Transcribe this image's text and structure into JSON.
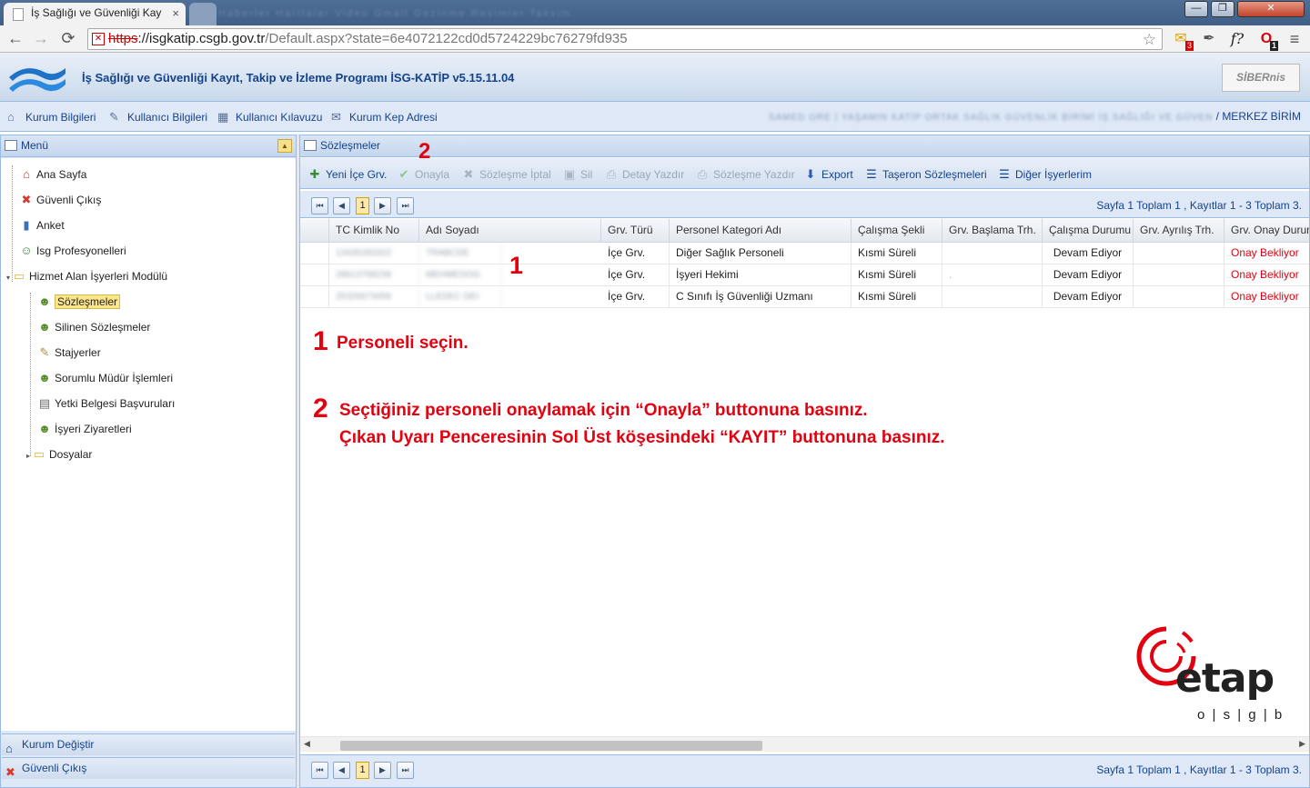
{
  "browser": {
    "tab_title": "İş Sağlığı ve Güvenliği Kay",
    "tab_close": "×",
    "blurred_tabs": "Haberler  Haritalar  Video  Gmail  Gezinme  Resimler  Takvim",
    "back": "←",
    "forward": "→",
    "reload": "⟳",
    "url_scheme": "https",
    "url_host": "://isgkatip.csgb.gov.tr",
    "url_path": "/Default.aspx?state=6e4072122cd0d5724229bc76279fd935",
    "star": "☆",
    "ext_mail_badge": "3",
    "ext_f": "f?",
    "ext_opera_badge": "1",
    "menu": "≡",
    "win_min": "—",
    "win_max": "❐",
    "win_close": "✕"
  },
  "app": {
    "title": "İş Sağlığı ve Güvenliği Kayıt, Takip ve İzleme Programı İSG-KATİP v5.15.11.04",
    "siber_logo": "SİBERnis",
    "topnav": [
      {
        "label": "Kurum Bilgileri",
        "icon": "home-icon",
        "glyph": "⌂"
      },
      {
        "label": "Kullanıcı Bilgileri",
        "icon": "user-pen-icon",
        "glyph": "✎"
      },
      {
        "label": "Kullanıcı Kılavuzu",
        "icon": "book-icon",
        "glyph": "▦"
      },
      {
        "label": "Kurum Kep Adresi",
        "icon": "mail-icon",
        "glyph": "✉"
      }
    ],
    "user_info_blurred": "SAMED ORE | YAŞAMIN KATİP ORTAK SAĞLIK GÜVENLİK BİRİMİ İŞ SAĞLIĞI VE GÜVEN",
    "user_info_suffix": " / MERKEZ BİRİM"
  },
  "menu": {
    "title": "Menü",
    "collapse": "▲",
    "items": [
      {
        "label": "Ana Sayfa",
        "icon": "home-icon",
        "glyph": "⌂",
        "color": "#c0392b"
      },
      {
        "label": "Güvenli Çıkış",
        "icon": "exit-icon",
        "glyph": "✖",
        "color": "#d63a2f"
      },
      {
        "label": "Anket",
        "icon": "chart-icon",
        "glyph": "▮",
        "color": "#3f6fb5"
      },
      {
        "label": "Isg Profesyonelleri",
        "icon": "users-icon",
        "glyph": "☺",
        "color": "#3a8a3a"
      },
      {
        "label": "Hizmet Alan İşyerleri Modülü",
        "icon": "folder-icon",
        "glyph": "▭",
        "color": "#e0b43a"
      },
      {
        "label": "Sözleşmeler",
        "icon": "contract-icon",
        "glyph": "☻",
        "color": "#5a8a2a"
      },
      {
        "label": "Silinen Sözleşmeler",
        "icon": "contract-icon",
        "glyph": "☻",
        "color": "#5a8a2a"
      },
      {
        "label": "Stajyerler",
        "icon": "pen-icon",
        "glyph": "✎",
        "color": "#b08a3a"
      },
      {
        "label": "Sorumlu Müdür İşlemleri",
        "icon": "contract-icon",
        "glyph": "☻",
        "color": "#5a8a2a"
      },
      {
        "label": "Yetki Belgesi Başvuruları",
        "icon": "document-icon",
        "glyph": "▤",
        "color": "#6a6a6a"
      },
      {
        "label": "İşyeri Ziyaretleri",
        "icon": "contract-icon",
        "glyph": "☻",
        "color": "#5a8a2a"
      },
      {
        "label": "Dosyalar",
        "icon": "folder-icon",
        "glyph": "▭",
        "color": "#e0b43a"
      }
    ],
    "footer": [
      {
        "label": "Kurum Değiştir",
        "icon": "building-icon",
        "glyph": "⌂"
      },
      {
        "label": "Güvenli Çıkış",
        "icon": "exit-icon",
        "glyph": "✖"
      }
    ]
  },
  "main": {
    "title": "Sözleşmeler",
    "toolbar": [
      {
        "label": "Yeni İçe Grv.",
        "icon": "add-icon",
        "glyph": "✚",
        "enabled": true
      },
      {
        "label": "Onayla",
        "icon": "check-icon",
        "glyph": "✔",
        "enabled": false
      },
      {
        "label": "Sözleşme İptal",
        "icon": "cancel-icon",
        "glyph": "✖",
        "enabled": false
      },
      {
        "label": "Sil",
        "icon": "delete-icon",
        "glyph": "▣",
        "enabled": false
      },
      {
        "label": "Detay Yazdır",
        "icon": "print-icon",
        "glyph": "⎙",
        "enabled": false
      },
      {
        "label": "Sözleşme Yazdır",
        "icon": "print-icon",
        "glyph": "⎙",
        "enabled": false
      },
      {
        "label": "Export",
        "icon": "export-icon",
        "glyph": "⬇",
        "enabled": true
      },
      {
        "label": "Taşeron Sözleşmeleri",
        "icon": "list-icon",
        "glyph": "☰",
        "enabled": true
      },
      {
        "label": "Diğer İşyerlerim",
        "icon": "list-icon",
        "glyph": "☰",
        "enabled": true
      }
    ],
    "pager": {
      "first": "⏮",
      "prev": "◀",
      "page": "1",
      "next": "▶",
      "last": "⏭",
      "summary_top": "Sayfa 1 Toplam 1 , Kayıtlar 1 - 3 Toplam 3.",
      "summary_bottom": "Sayfa 1 Toplam 1 , Kayıtlar 1 - 3 Toplam 3."
    },
    "columns": [
      "TC Kimlik No",
      "Adı Soyadı",
      "Grv. Türü",
      "Personel Kategori Adı",
      "Çalışma Şekli",
      "Grv. Başlama Trh.",
      "Çalışma Durumu",
      "Grv. Ayrılış Trh.",
      "Grv. Onay Durum"
    ],
    "rows": [
      [
        "13435283322",
        "TRABCDE",
        "İçe Grv.",
        "Diğer Sağlık Personeli",
        "Kısmi Süreli",
        "",
        "Devam Ediyor",
        "",
        "Onay Bekliyor"
      ],
      [
        "28613768238",
        "MEHMEDOG",
        "İçe Grv.",
        "İşyeri Hekimi",
        "Kısmi Süreli",
        ".",
        "Devam Ediyor",
        "",
        "Onay Bekliyor"
      ],
      [
        "25326673456",
        "LLEDEC DEI",
        "İçe Grv.",
        "C Sınıfı İş Güvenliği Uzmanı",
        "Kısmi Süreli",
        "",
        "Devam Ediyor",
        "",
        "Onay Bekliyor"
      ]
    ],
    "annotations": {
      "num1_grid": "1",
      "num2_toolbar": "2",
      "step1_num": "1",
      "step1_text": "Personeli seçin.",
      "step2_num": "2",
      "step2_line1": "Seçtiğiniz personeli onaylamak için “Onayla” buttonuna basınız.",
      "step2_line2": "Çıkan Uyarı Penceresinin Sol Üst köşesindeki “KAYIT” buttonuna basınız."
    },
    "scroll_left": "◀",
    "scroll_right": "▶"
  },
  "watermark": {
    "brand": "etap",
    "sub": "o | s | g | b"
  },
  "colors": {
    "accent_red": "#e3000f",
    "ext_blue": "#15428b",
    "panel_bg": "#dfe8f6"
  }
}
